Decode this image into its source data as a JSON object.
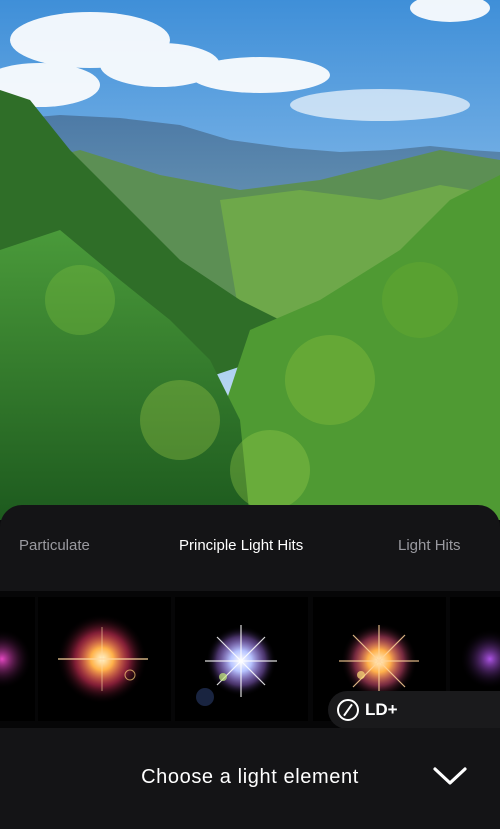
{
  "photo": {
    "subject": "forest-valley-landscape"
  },
  "tabs": [
    {
      "label": "Particulate",
      "active": false
    },
    {
      "label": "Principle Light Hits",
      "active": true
    },
    {
      "label": "Light Hits",
      "active": false
    }
  ],
  "thumbnails": [
    {
      "name": "flare-partial-left",
      "colors": [
        "#ff4fd8",
        "#7aa0ff"
      ]
    },
    {
      "name": "flare-warm-pink",
      "colors": [
        "#ff3a6a",
        "#ffd27a"
      ]
    },
    {
      "name": "flare-blue-star",
      "colors": [
        "#ffffff",
        "#b07bff"
      ]
    },
    {
      "name": "flare-orange-star",
      "colors": [
        "#ffb04a",
        "#ff5a8a"
      ]
    },
    {
      "name": "flare-partial-right",
      "colors": [
        "#c05cff",
        "#5a7cff"
      ]
    }
  ],
  "badge": {
    "label": "LD+",
    "icon": "no-sign-icon"
  },
  "footer": {
    "prompt": "Choose a light element",
    "icon": "chevron-down-icon"
  },
  "colors": {
    "panel": "#141416",
    "strip": "#060607",
    "active_text": "#ffffff",
    "inactive_text": "#9a9aa0"
  }
}
